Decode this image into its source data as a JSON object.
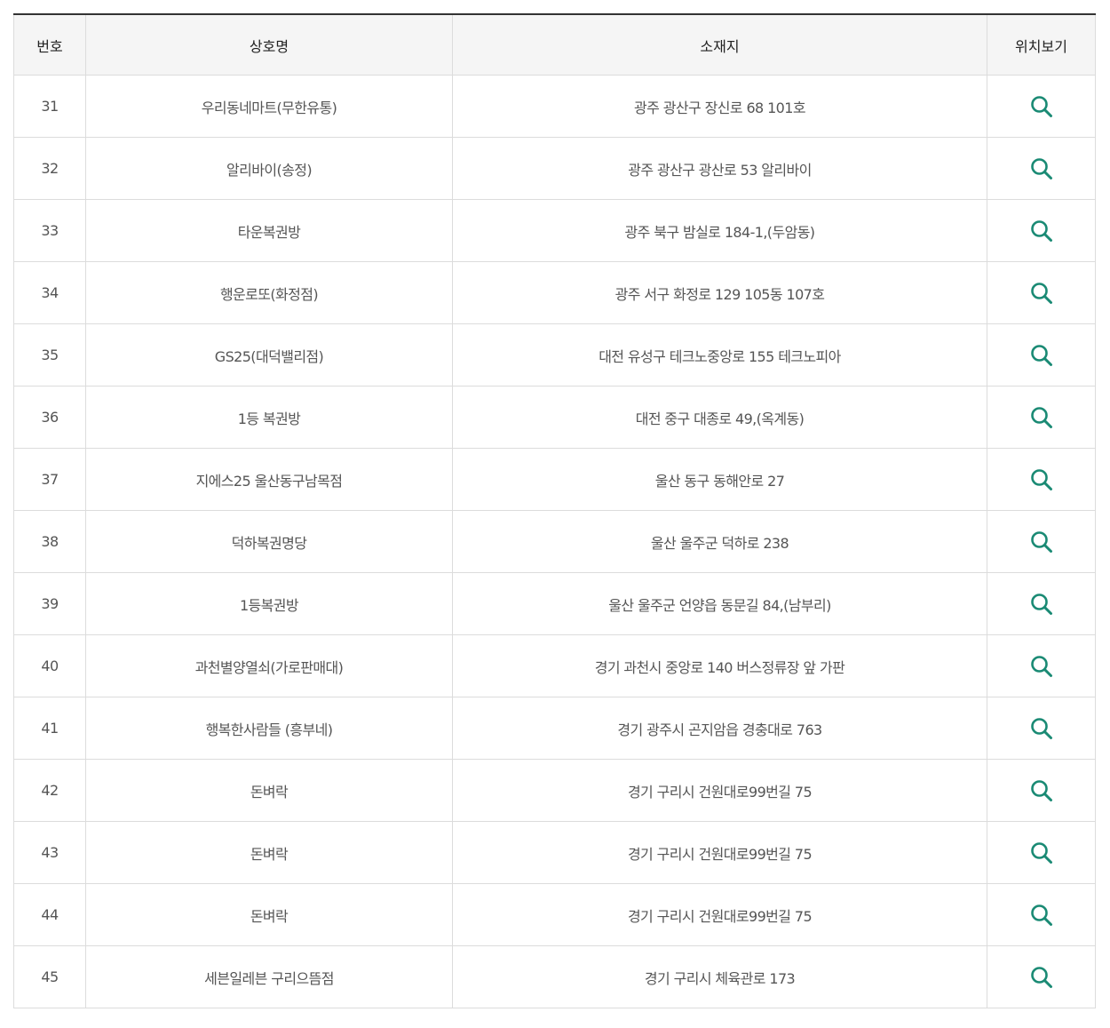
{
  "table": {
    "headers": {
      "number": "번호",
      "name": "상호명",
      "address": "소재지",
      "location": "위치보기"
    },
    "rows": [
      {
        "number": "31",
        "name": "우리동네마트(무한유통)",
        "address": "광주 광산구 장신로 68 101호"
      },
      {
        "number": "32",
        "name": "알리바이(송정)",
        "address": "광주 광산구 광산로 53 알리바이"
      },
      {
        "number": "33",
        "name": "타운복권방",
        "address": "광주 북구 밤실로 184-1,(두암동)"
      },
      {
        "number": "34",
        "name": "행운로또(화정점)",
        "address": "광주 서구 화정로 129 105동 107호"
      },
      {
        "number": "35",
        "name": "GS25(대덕밸리점)",
        "address": "대전 유성구 테크노중앙로 155 테크노피아"
      },
      {
        "number": "36",
        "name": "1등 복권방",
        "address": "대전 중구 대종로 49,(옥계동)"
      },
      {
        "number": "37",
        "name": "지에스25 울산동구남목점",
        "address": "울산 동구 동해안로 27"
      },
      {
        "number": "38",
        "name": "덕하복권명당",
        "address": "울산 울주군 덕하로 238"
      },
      {
        "number": "39",
        "name": "1등복권방",
        "address": "울산 울주군 언양읍 동문길 84,(남부리)"
      },
      {
        "number": "40",
        "name": "과천별양열쇠(가로판매대)",
        "address": "경기 과천시 중앙로 140 버스정류장 앞 가판"
      },
      {
        "number": "41",
        "name": "행복한사람들 (흥부네)",
        "address": "경기 광주시 곤지암읍 경충대로 763"
      },
      {
        "number": "42",
        "name": "돈벼락",
        "address": "경기 구리시 건원대로99번길 75"
      },
      {
        "number": "43",
        "name": "돈벼락",
        "address": "경기 구리시 건원대로99번길 75"
      },
      {
        "number": "44",
        "name": "돈벼락",
        "address": "경기 구리시 건원대로99번길 75"
      },
      {
        "number": "45",
        "name": "세븐일레븐 구리으뜸점",
        "address": "경기 구리시 체육관로 173"
      }
    ]
  },
  "icons": {
    "location": "search-icon"
  },
  "colors": {
    "icon": "#1a8a74",
    "header_border": "#333333",
    "header_bg": "#f5f5f5",
    "grid": "#dcdcdc"
  }
}
